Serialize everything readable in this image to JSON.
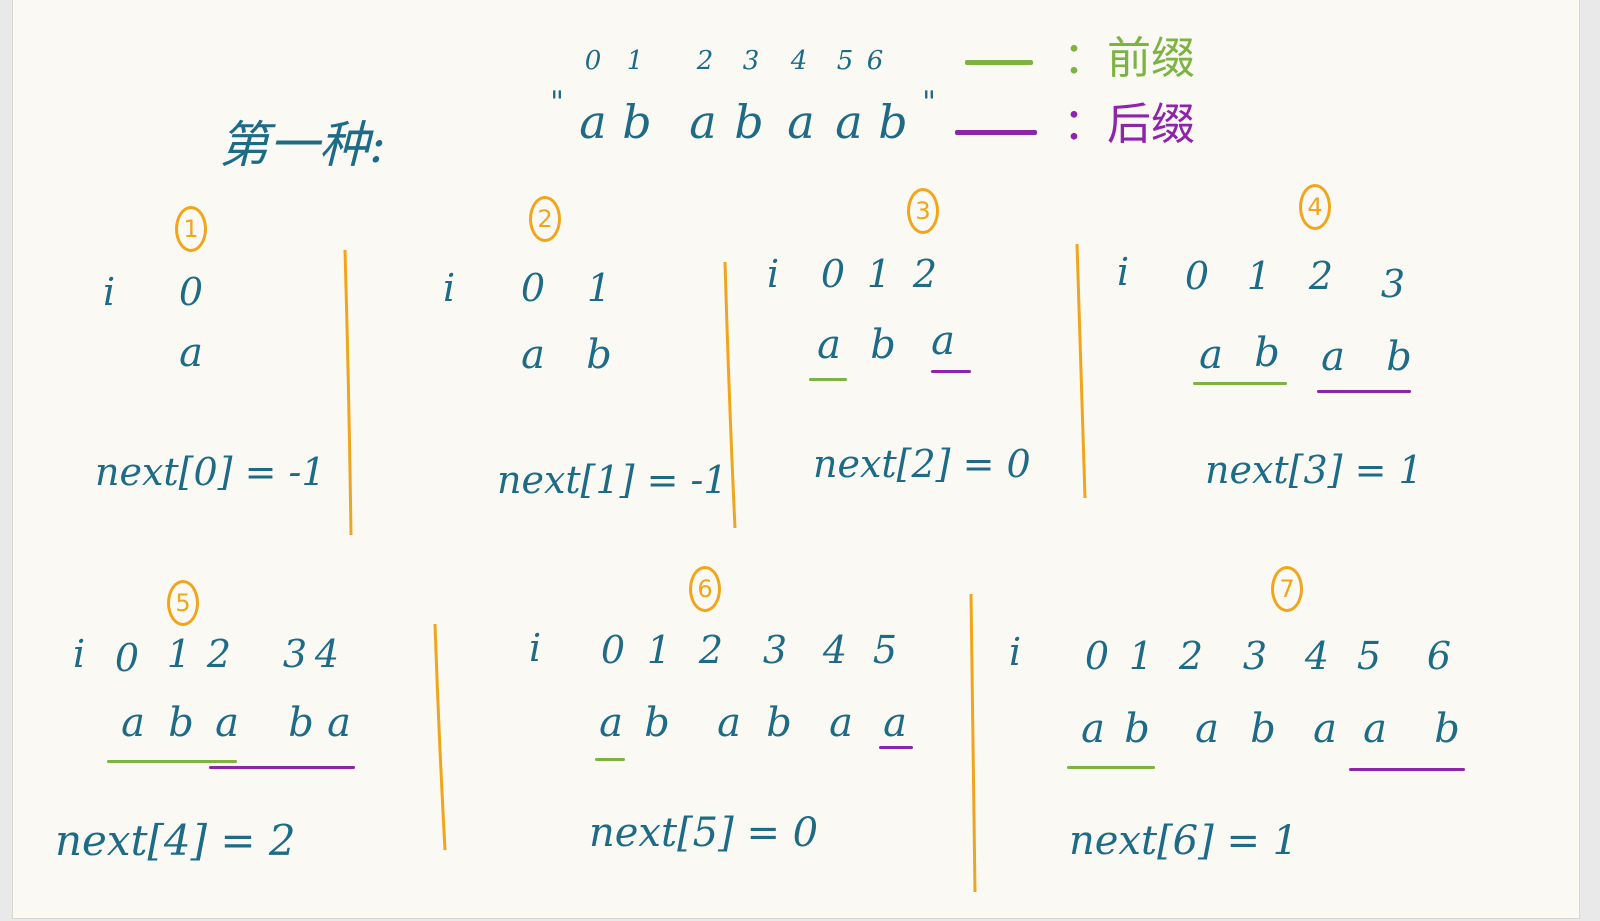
{
  "title": "第一种:",
  "top_indices": [
    "0",
    "1",
    "2",
    "3",
    "4",
    "5",
    "6"
  ],
  "string": {
    "open_quote": "\"",
    "chars": [
      "a",
      "b",
      "a",
      "b",
      "a",
      "a",
      "b"
    ],
    "close_quote": "\""
  },
  "legend": {
    "prefix": {
      "label": "：前缀",
      "color": "#7cb342"
    },
    "suffix": {
      "label": "：后缀",
      "color": "#8e24aa"
    }
  },
  "colors": {
    "ink": "#1d6b86",
    "divider": "#f2a51b",
    "badge": "#f2a51b"
  },
  "steps": [
    {
      "badge": "1",
      "i_label": "i",
      "indices": [
        "0"
      ],
      "chars": [
        "a"
      ],
      "next": "next[0] = -1"
    },
    {
      "badge": "2",
      "i_label": "i",
      "indices": [
        "0",
        "1"
      ],
      "chars": [
        "a",
        "b"
      ],
      "next": "next[1] = -1"
    },
    {
      "badge": "3",
      "i_label": "i",
      "indices": [
        "0",
        "1",
        "2"
      ],
      "chars": [
        "a",
        "b",
        "a"
      ],
      "next": "next[2] = 0"
    },
    {
      "badge": "4",
      "i_label": "i",
      "indices": [
        "0",
        "1",
        "2",
        "3"
      ],
      "chars": [
        "a",
        "b",
        "a",
        "b"
      ],
      "next": "next[3] = 1"
    },
    {
      "badge": "5",
      "i_label": "i",
      "indices": [
        "0",
        "1",
        "2",
        "3",
        "4"
      ],
      "chars": [
        "a",
        "b",
        "a",
        "b",
        "a"
      ],
      "next": "next[4] = 2"
    },
    {
      "badge": "6",
      "i_label": "i",
      "indices": [
        "0",
        "1",
        "2",
        "3",
        "4",
        "5"
      ],
      "chars": [
        "a",
        "b",
        "a",
        "b",
        "a",
        "a"
      ],
      "next": "next[5] = 0"
    },
    {
      "badge": "7",
      "i_label": "i",
      "indices": [
        "0",
        "1",
        "2",
        "3",
        "4",
        "5",
        "6"
      ],
      "chars": [
        "a",
        "b",
        "a",
        "b",
        "a",
        "a",
        "b"
      ],
      "next": "next[6] = 1"
    }
  ]
}
